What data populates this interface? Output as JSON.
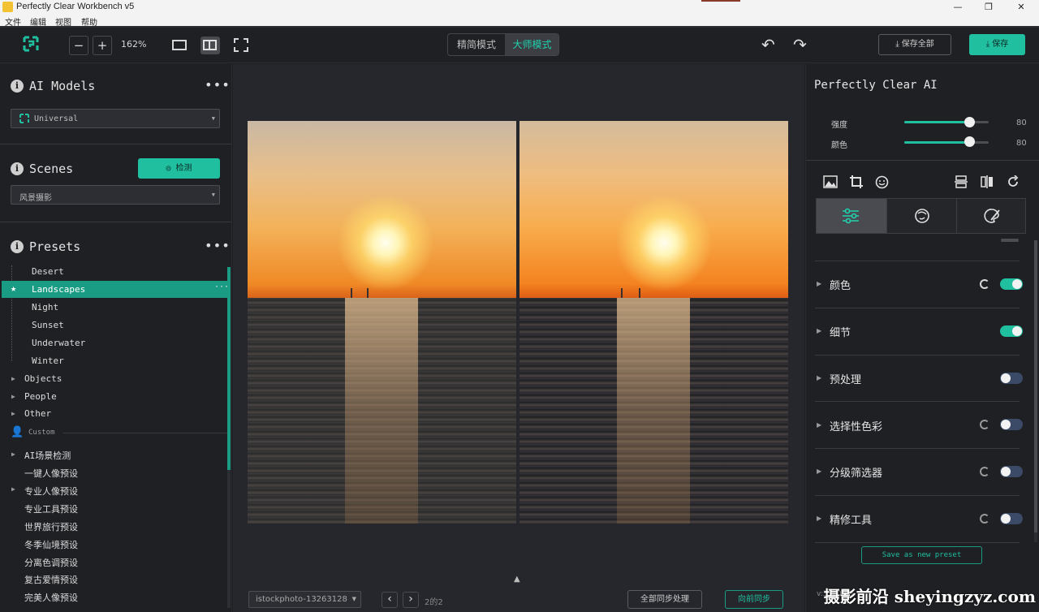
{
  "window": {
    "title": "Perfectly Clear Workbench v5",
    "minimize": "—",
    "maximize": "❐",
    "close": "✕"
  },
  "menu": [
    "文件",
    "编辑",
    "视图",
    "帮助"
  ],
  "toolbar": {
    "zoom_out": "−",
    "zoom_in": "+",
    "zoom_level": "162%",
    "mode_simple": "精简模式",
    "mode_master": "大师模式",
    "undo": "↶",
    "redo": "↷",
    "save_all": "保存全部",
    "save": "保存",
    "accent": "#1fbfa0"
  },
  "left": {
    "ai_models": {
      "title": "AI Models",
      "more": "•••",
      "selected": "Universal"
    },
    "scenes": {
      "title": "Scenes",
      "detect": "检测",
      "selected": "风景摄影"
    },
    "presets": {
      "title": "Presets",
      "more": "•••",
      "landscape_children": [
        "Desert",
        "Landscapes",
        "Night",
        "Sunset",
        "Underwater",
        "Winter"
      ],
      "selected": "Landscapes",
      "selected_more": "···",
      "groups": [
        "Objects",
        "People",
        "Other"
      ],
      "custom_label": "Custom",
      "custom_items": [
        "AI场景检测",
        "一键人像预设",
        "专业人像预设",
        "专业工具预设",
        "世界旅行预设",
        "冬季仙境预设",
        "分离色调预设",
        "复古爱情预设",
        "完美人像预设"
      ]
    }
  },
  "center": {
    "file_name": "istockphoto-13263128",
    "prev": "‹",
    "next": "›",
    "page": "2的2",
    "expand": "▲",
    "sync_all": "全部同步处理",
    "sync_forward": "向前同步"
  },
  "right": {
    "title": "Perfectly Clear AI",
    "sliders": [
      {
        "label": "强度",
        "value": 80,
        "max": 100
      },
      {
        "label": "颜色",
        "value": 80,
        "max": 100
      }
    ],
    "sections": [
      {
        "label": "颜色",
        "on": true,
        "reset": true
      },
      {
        "label": "细节",
        "on": true,
        "reset": false
      },
      {
        "label": "预处理",
        "on": false,
        "reset": false
      },
      {
        "label": "选择性色彩",
        "on": false,
        "reset": true
      },
      {
        "label": "分级筛选器",
        "on": false,
        "reset": true
      },
      {
        "label": "精修工具",
        "on": false,
        "reset": true
      }
    ],
    "save_preset": "Save as new preset",
    "version": "v:5.0.0.30"
  },
  "watermark": "摄影前沿 sheyingzyz.com"
}
